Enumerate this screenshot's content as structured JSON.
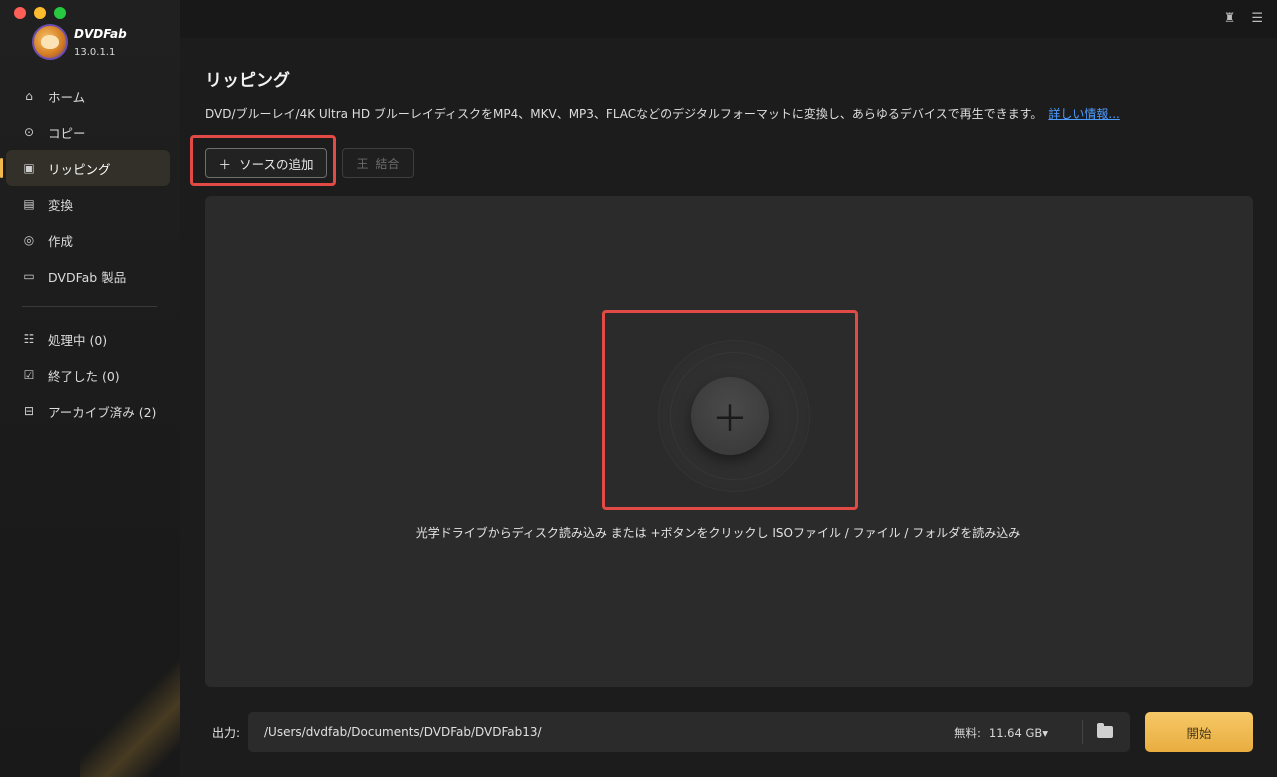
{
  "app": {
    "name": "DVDFab",
    "version": "13.0.1.1"
  },
  "sidebar": {
    "items": [
      {
        "label": "ホーム",
        "icon": "home-icon"
      },
      {
        "label": "コピー",
        "icon": "copy-icon"
      },
      {
        "label": "リッピング",
        "icon": "ripper-icon",
        "active": true
      },
      {
        "label": "変換",
        "icon": "convert-icon"
      },
      {
        "label": "作成",
        "icon": "creator-icon"
      },
      {
        "label": "DVDFab 製品",
        "icon": "products-icon"
      }
    ],
    "queue": [
      {
        "label": "処理中 (0)",
        "icon": "processing-icon"
      },
      {
        "label": "終了した (0)",
        "icon": "finished-icon"
      },
      {
        "label": "アーカイブ済み (2)",
        "icon": "archive-icon"
      }
    ]
  },
  "main": {
    "title": "リッピング",
    "description": "DVD/ブルーレイ/4K Ultra HD ブルーレイディスクをMP4、MKV、MP3、FLACなどのデジタルフォーマットに変換し、あらゆるデバイスで再生できます。",
    "more_link": "詳しい情報...",
    "add_source_label": "ソースの追加",
    "merge_label": "結合",
    "drop_hint": "光学ドライブからディスク読み込み または +ボタンをクリックし ISOファイル / ファイル / フォルダを読み込み"
  },
  "footer": {
    "output_label": "出力:",
    "output_path": "/Users/dvdfab/Documents/DVDFab/DVDFab13/",
    "free_label": "無料:",
    "free_space": "11.64 GB",
    "start_label": "開始"
  },
  "colors": {
    "accent": "#f2b94b",
    "highlight": "#e24a45",
    "link": "#4d9cff",
    "start_button": "#f0bb55"
  }
}
